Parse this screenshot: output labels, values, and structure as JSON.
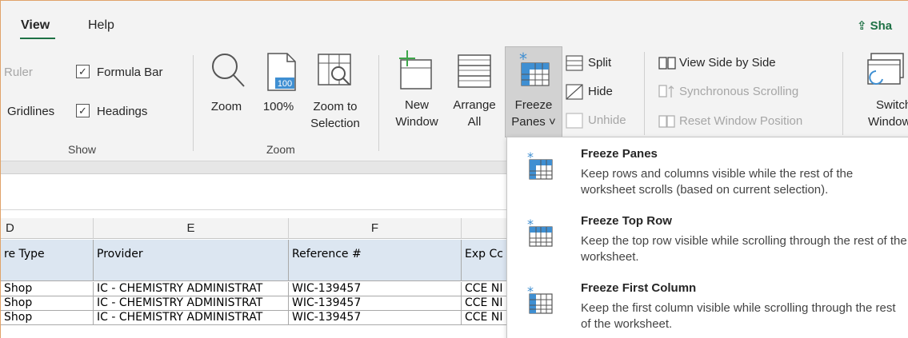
{
  "tabs": [
    {
      "label": "View",
      "active": true
    },
    {
      "label": "Help",
      "active": false
    }
  ],
  "share_label": "Sha",
  "ribbon": {
    "show_group": {
      "label": "Show",
      "ruler": "Ruler",
      "gridlines": "Gridlines",
      "formula_bar": "Formula Bar",
      "headings": "Headings",
      "formula_bar_checked": "✓",
      "headings_checked": "✓"
    },
    "zoom_group": {
      "label": "Zoom",
      "zoom": "Zoom",
      "hundred": "100%",
      "hundred_icon_text": "100",
      "zoom_to_line1": "Zoom to",
      "zoom_to_line2": "Selection"
    },
    "window_group": {
      "new_line1": "New",
      "new_line2": "Window",
      "arrange_line1": "Arrange",
      "arrange_line2": "All",
      "freeze_line1": "Freeze",
      "freeze_line2": "Panes ˅",
      "split": "Split",
      "hide": "Hide",
      "unhide": "Unhide",
      "side_by_side": "View Side by Side",
      "sync_scroll": "Synchronous Scrolling",
      "reset_position": "Reset Window Position",
      "switch_line1": "Switch",
      "switch_line2": "Windows"
    }
  },
  "grid": {
    "columns": [
      "D",
      "E",
      "F",
      ""
    ],
    "header_cells": [
      "re Type",
      "Provider",
      "Reference #",
      "Exp Cc"
    ],
    "rows": [
      [
        "Shop",
        "IC - CHEMISTRY ADMINISTRAT",
        "WIC-139457",
        "CCE NI"
      ],
      [
        "Shop",
        "IC - CHEMISTRY ADMINISTRAT",
        "WIC-139457",
        "CCE NI"
      ],
      [
        "Shop",
        "IC - CHEMISTRY ADMINISTRAT",
        "WIC-139457",
        "CCE NI"
      ]
    ]
  },
  "freeze_menu": [
    {
      "title": "Freeze Panes",
      "description": "Keep rows and columns visible while the rest of the worksheet scrolls (based on current selection)."
    },
    {
      "title": "Freeze Top Row",
      "description": "Keep the top row visible while scrolling through the rest of the worksheet."
    },
    {
      "title": "Freeze First Column",
      "description": "Keep the first column visible while scrolling through the rest of the worksheet."
    }
  ],
  "colors": {
    "accent": "#1e7145",
    "icon_blue": "#3f8fd2",
    "selected_button": "#d2d2d2"
  }
}
